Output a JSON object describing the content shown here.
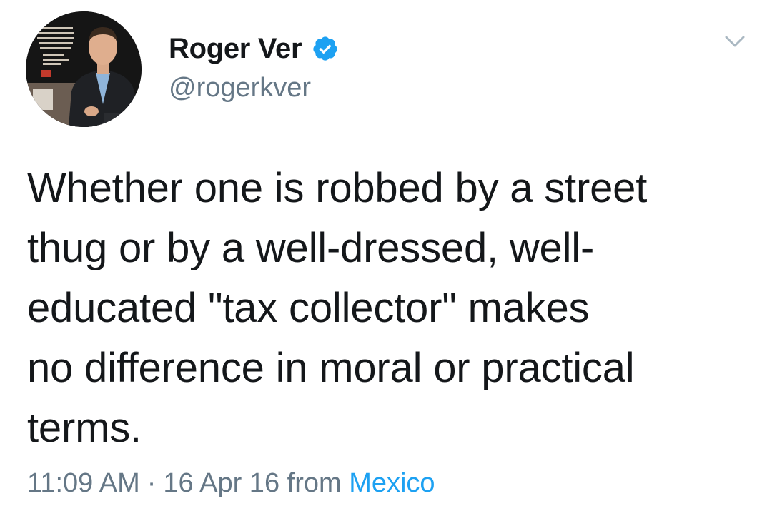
{
  "author": {
    "display_name": "Roger Ver",
    "handle": "@rogerkver",
    "verified": true,
    "avatar_icon": "profile-photo-man-in-suit"
  },
  "tweet": {
    "text": "Whether one is robbed by a street\nthug or by a well-dressed, well-\neducated \"tax collector\" makes\nno difference in moral or practical\nterms.",
    "time": "11:09 AM",
    "separator": "·",
    "date": "16 Apr 16",
    "source_prefix": "from",
    "location": "Mexico"
  },
  "colors": {
    "text": "#14171a",
    "secondary": "#657786",
    "link": "#1da1f2",
    "verified": "#1da1f2"
  },
  "icons": {
    "verified": "verified-badge-icon",
    "more": "chevron-down-icon"
  }
}
